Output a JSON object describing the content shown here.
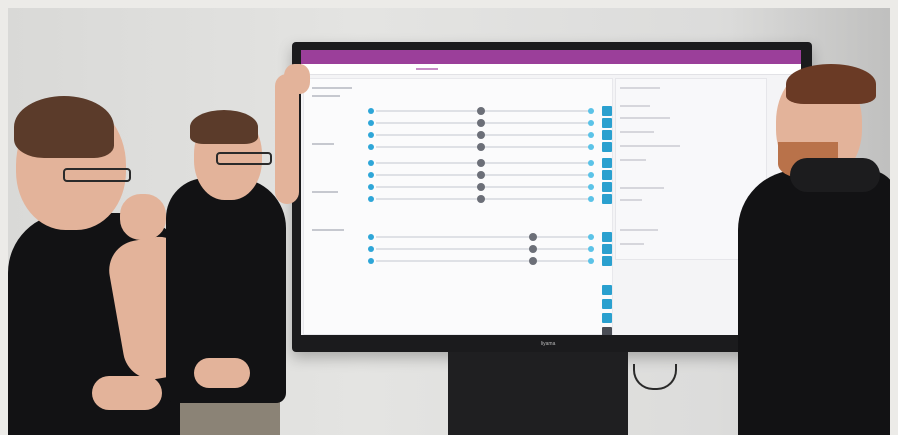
{
  "scene": {
    "description_tag": "",
    "display": {
      "brand_text": "Iiyama",
      "app_bar_color": "#9b3f9a",
      "accent_color": "#2aa0cf",
      "knob_color": "#6c6f78",
      "rows": [
        {
          "knob_pos": 0.48
        },
        {
          "knob_pos": 0.48
        },
        {
          "knob_pos": 0.48
        },
        {
          "knob_pos": 0.48
        },
        {
          "knob_pos": 0.48
        },
        {
          "knob_pos": 0.48
        },
        {
          "knob_pos": 0.48
        },
        {
          "knob_pos": 0.48
        },
        {
          "knob_pos": 0.72
        },
        {
          "knob_pos": 0.72
        },
        {
          "knob_pos": 0.72
        }
      ]
    },
    "people_count": 3
  }
}
